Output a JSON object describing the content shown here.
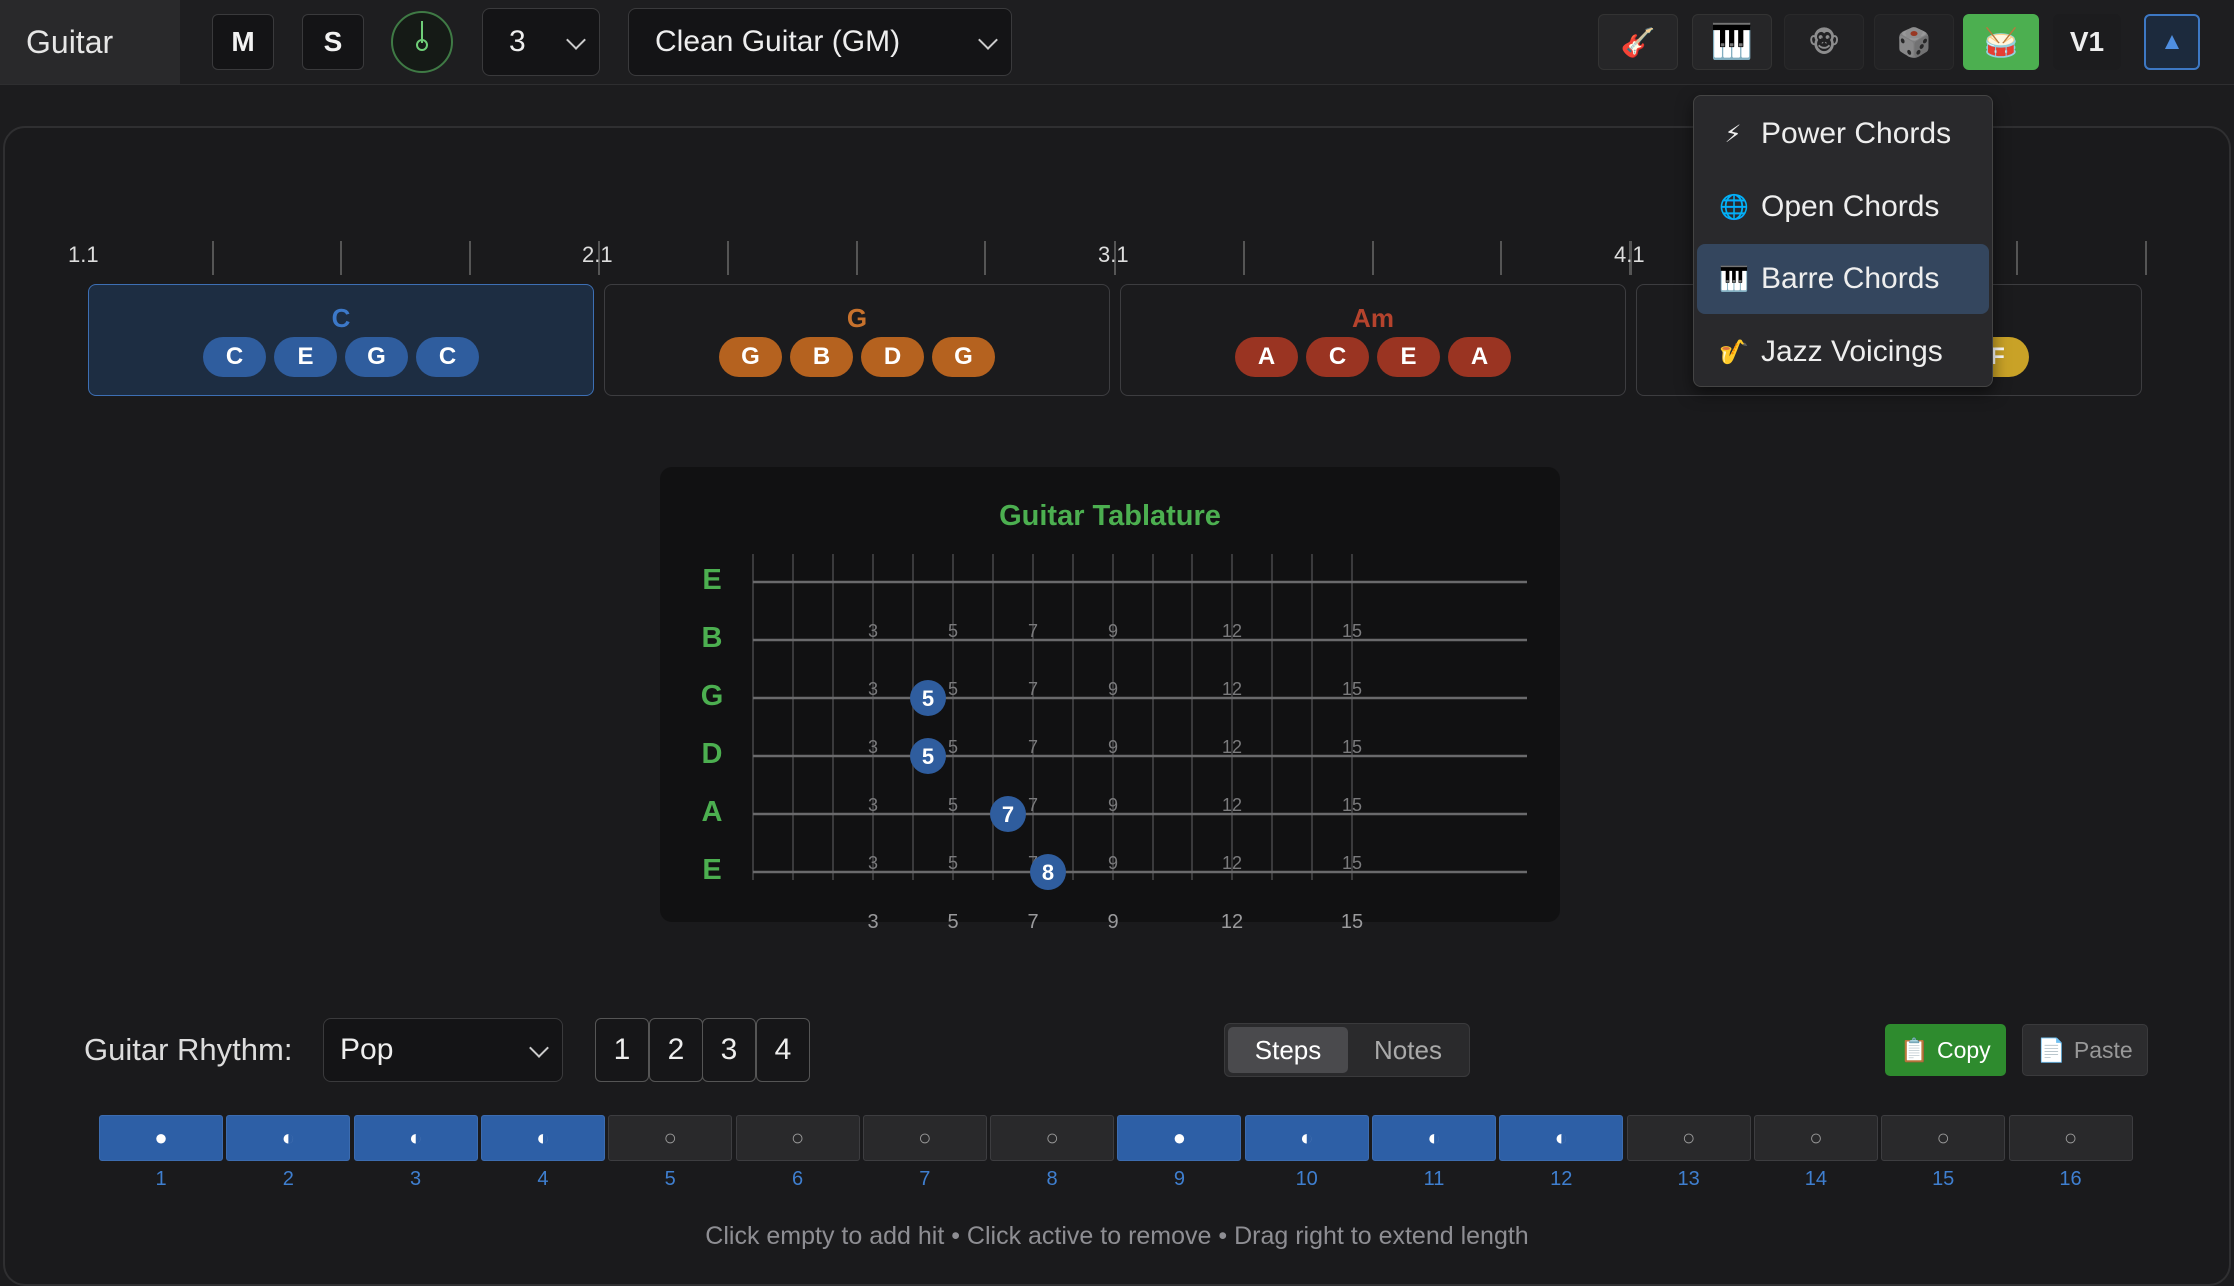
{
  "track": {
    "name": "Guitar"
  },
  "header": {
    "mute_label": "M",
    "solo_label": "S",
    "octave_value": "3",
    "instrument_value": "Clean Guitar (GM)",
    "version_label": "V1",
    "right_icons": [
      "guitar-icon",
      "piano-icon",
      "monkey-icon",
      "dice-icon",
      "drum-icon"
    ],
    "collapse_glyph": "▲",
    "accent": "#4caf50"
  },
  "ruler": {
    "labels": [
      "1.1",
      "2.1",
      "3.1",
      "4.1"
    ]
  },
  "chords": [
    {
      "name": "C",
      "notes": [
        "C",
        "E",
        "G",
        "C"
      ],
      "color": "#2f5d9e",
      "name_color": "#3c78c8"
    },
    {
      "name": "G",
      "notes": [
        "G",
        "B",
        "D",
        "G"
      ],
      "color": "#b5621f",
      "name_color": "#c7722d"
    },
    {
      "name": "Am",
      "notes": [
        "A",
        "C",
        "E",
        "A"
      ],
      "color": "#9a3422",
      "name_color": "#b5432d"
    },
    {
      "name": "",
      "notes": [
        "F"
      ],
      "color": "#c9a227",
      "name_color": "#c9a227"
    }
  ],
  "voicing_menu": {
    "items": [
      {
        "icon": "⚡",
        "label": "Power Chords"
      },
      {
        "icon": "🌐",
        "label": "Open Chords"
      },
      {
        "icon": "🎹",
        "label": "Barre Chords"
      },
      {
        "icon": "🎷",
        "label": "Jazz Voicings"
      }
    ],
    "selected": "Barre Chords"
  },
  "tab": {
    "title": "Guitar Tablature",
    "strings": [
      "E",
      "B",
      "G",
      "D",
      "A",
      "E"
    ],
    "fret_markers": [
      "3",
      "5",
      "7",
      "9",
      "12",
      "15"
    ],
    "played": [
      {
        "string": "G",
        "fret": "5"
      },
      {
        "string": "D",
        "fret": "5"
      },
      {
        "string": "A",
        "fret": "7"
      },
      {
        "string": "E",
        "fret": "8"
      }
    ]
  },
  "rhythm": {
    "label": "Guitar Rhythm:",
    "pattern_value": "Pop",
    "bar_buttons": [
      "1",
      "2",
      "3",
      "4"
    ],
    "modes": [
      "Steps",
      "Notes"
    ],
    "active_mode": "Steps",
    "copy_label": "Copy",
    "paste_label": "Paste",
    "steps": [
      {
        "num": "1",
        "state": "full"
      },
      {
        "num": "2",
        "state": "half"
      },
      {
        "num": "3",
        "state": "half"
      },
      {
        "num": "4",
        "state": "half"
      },
      {
        "num": "5",
        "state": "empty"
      },
      {
        "num": "6",
        "state": "empty"
      },
      {
        "num": "7",
        "state": "empty"
      },
      {
        "num": "8",
        "state": "empty"
      },
      {
        "num": "9",
        "state": "full"
      },
      {
        "num": "10",
        "state": "half"
      },
      {
        "num": "11",
        "state": "half"
      },
      {
        "num": "12",
        "state": "half"
      },
      {
        "num": "13",
        "state": "empty"
      },
      {
        "num": "14",
        "state": "empty"
      },
      {
        "num": "15",
        "state": "empty"
      },
      {
        "num": "16",
        "state": "empty"
      }
    ],
    "hint": "Click empty to add hit • Click active to remove • Drag right to extend length"
  }
}
